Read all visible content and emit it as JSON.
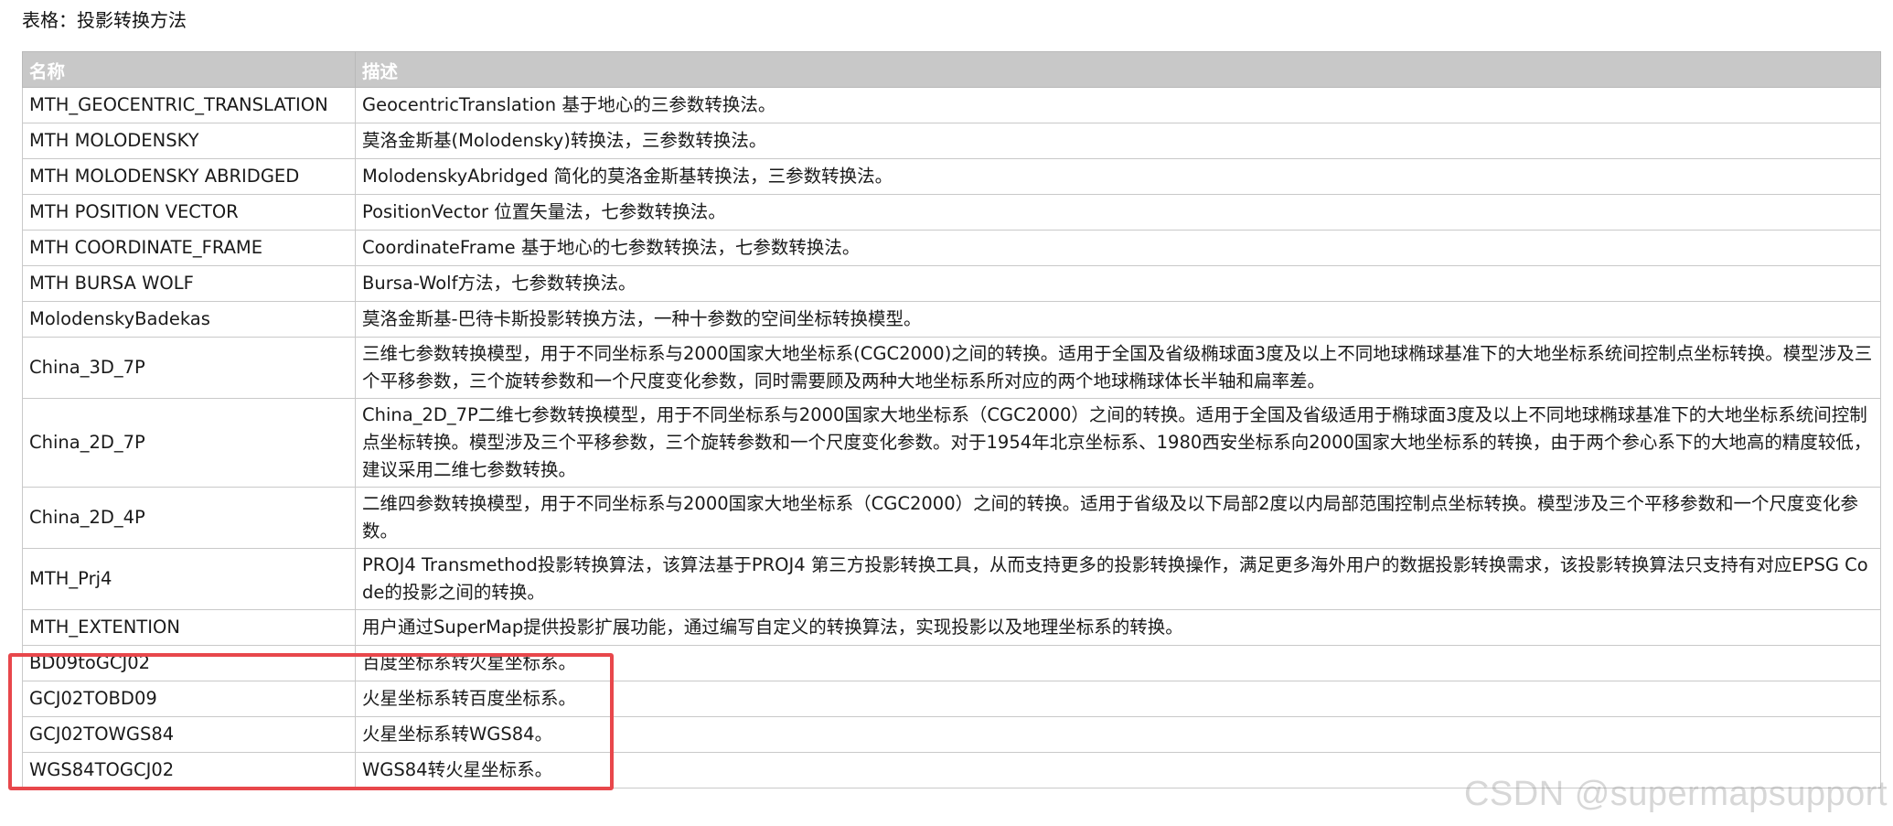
{
  "caption": "表格：投影转换方法",
  "table": {
    "headers": [
      "名称",
      "描述"
    ],
    "rows": [
      {
        "name": "MTH_GEOCENTRIC_TRANSLATION",
        "desc": "GeocentricTranslation 基于地心的三参数转换法。"
      },
      {
        "name": "MTH MOLODENSKY",
        "desc": "莫洛金斯基(Molodensky)转换法，三参数转换法。"
      },
      {
        "name": "MTH MOLODENSKY ABRIDGED",
        "desc": "MolodenskyAbridged 简化的莫洛金斯基转换法，三参数转换法。"
      },
      {
        "name": "MTH POSITION VECTOR",
        "desc": "PositionVector 位置矢量法，七参数转换法。"
      },
      {
        "name": "MTH COORDINATE_FRAME",
        "desc": "CoordinateFrame 基于地心的七参数转换法，七参数转换法。"
      },
      {
        "name": "MTH BURSA WOLF",
        "desc": "Bursa-Wolf方法，七参数转换法。"
      },
      {
        "name": "MolodenskyBadekas",
        "desc": "莫洛金斯基-巴待卡斯投影转换方法，一种十参数的空间坐标转换模型。"
      },
      {
        "name": "China_3D_7P",
        "desc": "三维七参数转换模型，用于不同坐标系与2000国家大地坐标系(CGC2000)之间的转换。适用于全国及省级椭球面3度及以上不同地球椭球基准下的大地坐标系统间控制点坐标转换。模型涉及三个平移参数，三个旋转参数和一个尺度变化参数，同时需要顾及两种大地坐标系所对应的两个地球椭球体长半轴和扁率差。"
      },
      {
        "name": "China_2D_7P",
        "desc": "China_2D_7P二维七参数转换模型，用于不同坐标系与2000国家大地坐标系（CGC2000）之间的转换。适用于全国及省级适用于椭球面3度及以上不同地球椭球基准下的大地坐标系统间控制点坐标转换。模型涉及三个平移参数，三个旋转参数和一个尺度变化参数。对于1954年北京坐标系、1980西安坐标系向2000国家大地坐标系的转换，由于两个参心系下的大地高的精度较低，建议采用二维七参数转换。"
      },
      {
        "name": "China_2D_4P",
        "desc": "二维四参数转换模型，用于不同坐标系与2000国家大地坐标系（CGC2000）之间的转换。适用于省级及以下局部2度以内局部范围控制点坐标转换。模型涉及三个平移参数和一个尺度变化参数。"
      },
      {
        "name": "MTH_Prj4",
        "desc": "PROJ4 Transmethod投影转换算法，该算法基于PROJ4 第三方投影转换工具，从而支持更多的投影转换操作，满足更多海外用户的数据投影转换需求，该投影转换算法只支持有对应EPSG Code的投影之间的转换。"
      },
      {
        "name": "MTH_EXTENTION",
        "desc": "用户通过SuperMap提供投影扩展功能，通过编写自定义的转换算法，实现投影以及地理坐标系的转换。"
      },
      {
        "name": "BD09toGCJ02",
        "desc": "百度坐标系转火星坐标系。"
      },
      {
        "name": "GCJ02TOBD09",
        "desc": "火星坐标系转百度坐标系。"
      },
      {
        "name": "GCJ02TOWGS84",
        "desc": "火星坐标系转WGS84。"
      },
      {
        "name": "WGS84TOGCJ02",
        "desc": "WGS84转火星坐标系。"
      }
    ]
  },
  "highlight_color": "#e8474b",
  "header_bg_color": "#c8c8c8",
  "watermark": "CSDN @supermapsupport"
}
